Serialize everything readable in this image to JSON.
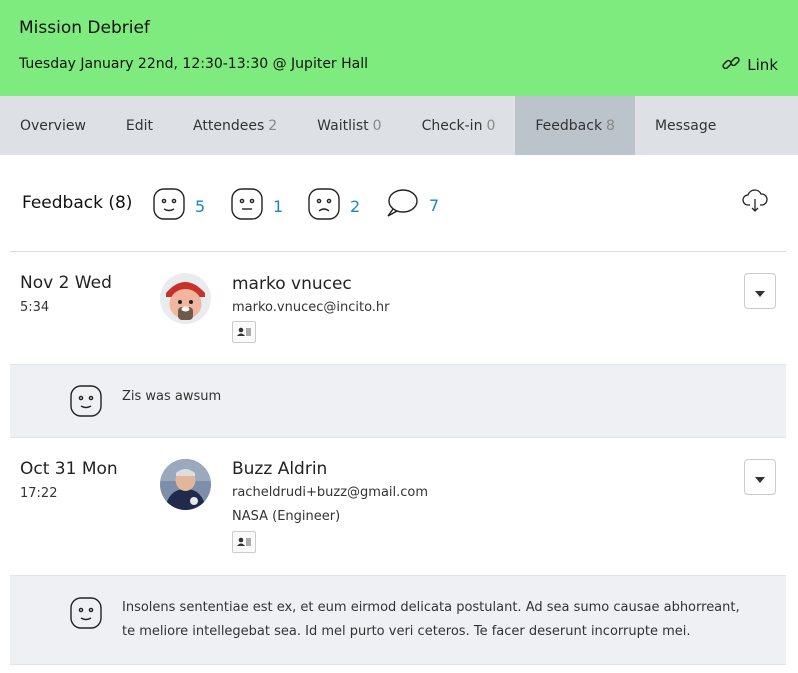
{
  "header": {
    "title": "Mission Debrief",
    "subtitle": "Tuesday January 22nd, 12:30-13:30 @ Jupiter Hall",
    "link_label": "Link",
    "bg_color": "#7deb7d"
  },
  "tabs": [
    {
      "label": "Overview",
      "count": ""
    },
    {
      "label": "Edit",
      "count": ""
    },
    {
      "label": "Attendees",
      "count": "2"
    },
    {
      "label": "Waitlist",
      "count": "0"
    },
    {
      "label": "Check-in",
      "count": "0"
    },
    {
      "label": "Feedback",
      "count": "8",
      "active": true
    },
    {
      "label": "Message",
      "count": ""
    }
  ],
  "feedback": {
    "title": "Feedback (8)",
    "happy_count": "5",
    "neutral_count": "1",
    "sad_count": "2",
    "comments_count": "7",
    "accent_color": "#1a86c4"
  },
  "entries": [
    {
      "date": "Nov 2 Wed",
      "time": "5:34",
      "name": "marko vnucec",
      "email": "marko.vnucec@incito.hr",
      "org": "",
      "comment": "Zis was awsum",
      "comment_line2": "",
      "mood": "happy"
    },
    {
      "date": "Oct 31 Mon",
      "time": "17:22",
      "name": "Buzz Aldrin",
      "email": "racheldrudi+buzz@gmail.com",
      "org": "NASA (Engineer)",
      "comment": "Insolens sententiae est ex, et eum eirmod delicata postulant. Ad sea sumo causae abhorreant,",
      "comment_line2": "te meliore intellegebat sea. Id mel purto veri ceteros. Te facer deserunt incorrupte mei.",
      "mood": "happy"
    }
  ]
}
